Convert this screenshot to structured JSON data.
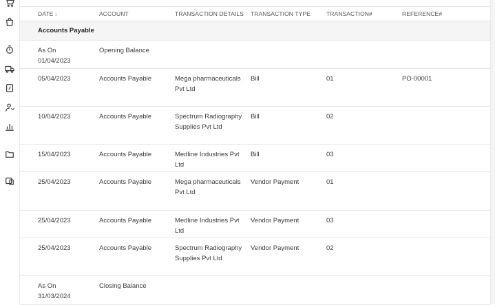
{
  "sidebar": {
    "icons": [
      "cart-icon",
      "bag-icon",
      "stopwatch-icon",
      "truck-icon",
      "invoice-icon",
      "user-tie-icon",
      "bar-chart-icon",
      "folder-icon",
      "bill-scan-icon"
    ]
  },
  "table": {
    "headers": {
      "date": "DATE",
      "account": "ACCOUNT",
      "details": "TRANSACTION DETAILS",
      "type": "TRANSACTION TYPE",
      "number": "TRANSACTION#",
      "reference": "REFERENCE#"
    },
    "sort_indicator": "↕",
    "group_label": "Accounts Payable",
    "rows": [
      {
        "date": "As On 01/04/2023",
        "account": "Opening Balance",
        "details": "",
        "type": "",
        "number": "",
        "reference": ""
      },
      {
        "date": "05/04/2023",
        "account": "Accounts Payable",
        "details": "Mega pharmaceuticals Pvt Ltd",
        "type": "Bill",
        "number": "01",
        "reference": "PO-00001"
      },
      {
        "date": "10/04/2023",
        "account": "Accounts Payable",
        "details": "Spectrum Radiography Supplies Pvt Ltd",
        "type": "Bill",
        "number": "02",
        "reference": ""
      },
      {
        "date": "15/04/2023",
        "account": "Accounts Payable",
        "details": "Medline Industries Pvt Ltd",
        "type": "Bill",
        "number": "03",
        "reference": ""
      },
      {
        "date": "25/04/2023",
        "account": "Accounts Payable",
        "details": "Mega pharmaceuticals Pvt Ltd",
        "type": "Vendor Payment",
        "number": "01",
        "reference": ""
      },
      {
        "date": "25/04/2023",
        "account": "Accounts Payable",
        "details": "Medline Industries Pvt Ltd",
        "type": "Vendor Payment",
        "number": "03",
        "reference": ""
      },
      {
        "date": "25/04/2023",
        "account": "Accounts Payable",
        "details": "Spectrum Radiography Supplies Pvt Ltd",
        "type": "Vendor Payment",
        "number": "02",
        "reference": ""
      },
      {
        "date": "As On 31/03/2024",
        "account": "Closing Balance",
        "details": "",
        "type": "",
        "number": "",
        "reference": ""
      }
    ]
  }
}
